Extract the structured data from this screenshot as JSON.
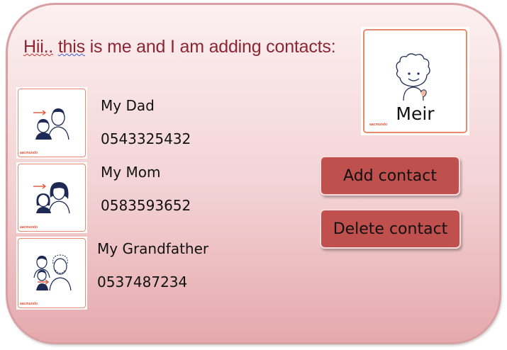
{
  "headline": {
    "part1": "Hii..",
    "part2": " ",
    "part3": "this",
    "part4": " is me and I am adding contacts:"
  },
  "profile": {
    "name": "Meir",
    "icon": "child-avatar-icon",
    "brand_mark": "aacmundo"
  },
  "contacts": [
    {
      "name": "My Dad",
      "phone": "0543325432",
      "icon": "child-and-father-icon"
    },
    {
      "name": "My Mom",
      "phone": "0583593652",
      "icon": "child-and-mother-icon"
    },
    {
      "name": "My Grandfather",
      "phone": "0537487234",
      "icon": "child-and-grandfather-icon"
    }
  ],
  "buttons": {
    "add_label": "Add contact",
    "delete_label": "Delete contact"
  },
  "colors": {
    "headline": "#8b2632",
    "button": "#c0504d",
    "card_border": "#d9a0a3",
    "thumb_border": "#e98a6d"
  }
}
